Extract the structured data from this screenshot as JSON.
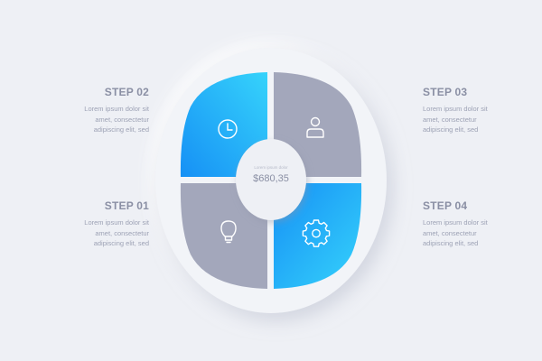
{
  "background": "#eef0f5",
  "colors": {
    "blue_light": "#2fd0fb",
    "blue_dark": "#1690f5",
    "gray": "#a3a7bb",
    "text_title": "#8a8fa4",
    "text_body": "#9da2b5"
  },
  "center": {
    "caption": "Lorem ipsum dolor",
    "amount": "$680,35"
  },
  "steps": [
    {
      "id": "step02",
      "title": "STEP 02",
      "lines": [
        "Lorem ipsum dolor sit",
        "amet, consectetur",
        "adipiscing elit, sed"
      ],
      "icon": "clock-icon",
      "color": "blue"
    },
    {
      "id": "step03",
      "title": "STEP 03",
      "lines": [
        "Lorem ipsum dolor sit",
        "amet, consectetur",
        "adipiscing elit, sed"
      ],
      "icon": "user-icon",
      "color": "gray"
    },
    {
      "id": "step01",
      "title": "STEP 01",
      "lines": [
        "Lorem ipsum dolor sit",
        "amet, consectetur",
        "adipiscing elit, sed"
      ],
      "icon": "lightbulb-icon",
      "color": "gray"
    },
    {
      "id": "step04",
      "title": "STEP 04",
      "lines": [
        "Lorem ipsum dolor sit",
        "amet, consectetur",
        "adipiscing elit, sed"
      ],
      "icon": "gear-icon",
      "color": "blue"
    }
  ]
}
